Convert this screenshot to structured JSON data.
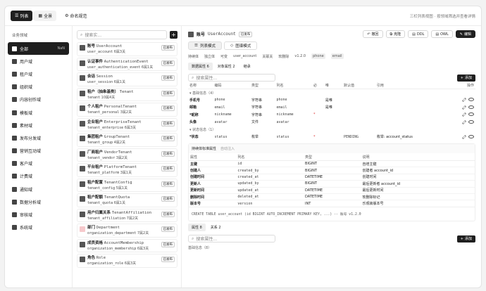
{
  "topbar": {
    "tabs": [
      "列表",
      "全景"
    ],
    "link": "命名规范",
    "hint": "三栏列表视图 · 按领域筛选并查看详情"
  },
  "sidebar": {
    "head": "业务领域",
    "items": [
      {
        "label": "全部",
        "count": "NaN"
      },
      {
        "label": "用户域"
      },
      {
        "label": "租户域"
      },
      {
        "label": "组织域"
      },
      {
        "label": "内容创作域"
      },
      {
        "label": "模板域"
      },
      {
        "label": "素材域"
      },
      {
        "label": "发布分发域"
      },
      {
        "label": "营销互动域"
      },
      {
        "label": "客户域"
      },
      {
        "label": "计费域"
      },
      {
        "label": "通知域"
      },
      {
        "label": "数据分析域"
      },
      {
        "label": "审核域"
      },
      {
        "label": "系统域"
      }
    ]
  },
  "list": {
    "search_placeholder": "搜索实...",
    "plus": "+",
    "entities": [
      {
        "cn": "账号",
        "en": "UserAccount",
        "tbl": "user_account",
        "meta": "6属3关",
        "pub": "已发布"
      },
      {
        "cn": "认证事件",
        "en": "AuthenticationEvent",
        "tbl": "user_authentication_event",
        "meta": "6属1关",
        "pub": "已发布"
      },
      {
        "cn": "会话",
        "en": "Session",
        "tbl": "user_session",
        "meta": "6属1关",
        "pub": "已发布"
      },
      {
        "cn": "租户（抽象基类）",
        "en": "Tenant",
        "tbl": "tenant",
        "meta": "10属4关",
        "pub": "已发布"
      },
      {
        "cn": "个人租户",
        "en": "PersonalTenant",
        "tbl": "tenant_personal",
        "meta": "3属2关",
        "pub": "已发布"
      },
      {
        "cn": "企业租户",
        "en": "EnterpriseTenant",
        "tbl": "tenant_enterprise",
        "meta": "6属3关",
        "pub": "已发布"
      },
      {
        "cn": "集团租户",
        "en": "GroupTenant",
        "tbl": "tenant_group",
        "meta": "4属2关",
        "pub": "已发布"
      },
      {
        "cn": "厂商租户",
        "en": "VendorTenant",
        "tbl": "tenant_vendor",
        "meta": "3属2关",
        "pub": "已发布"
      },
      {
        "cn": "平台租户",
        "en": "PlatformTenant",
        "tbl": "tenant_platform",
        "meta": "3属1关",
        "pub": "已发布"
      },
      {
        "cn": "租户配置",
        "en": "TenantConfig",
        "tbl": "tenant_config",
        "meta": "5属1关",
        "pub": "已发布"
      },
      {
        "cn": "租户配额",
        "en": "TenantQuota",
        "tbl": "tenant_quota",
        "meta": "6属1关",
        "pub": "已发布"
      },
      {
        "cn": "用户归属关系",
        "en": "TenantAffiliation",
        "tbl": "tenant_affiliation",
        "meta": "7属2关",
        "pub": "已发布"
      },
      {
        "cn": "部门",
        "en": "Department",
        "tbl": "organization_department",
        "meta": "7属2关",
        "pub": "已发布"
      },
      {
        "cn": "成员资格",
        "en": "AccountMembership",
        "tbl": "organization_membership",
        "meta": "6属3关",
        "pub": "已发布"
      },
      {
        "cn": "角色",
        "en": "Role",
        "tbl": "organization_role",
        "meta": "6属3关",
        "pub": "已发布"
      }
    ]
  },
  "main": {
    "title": "账号",
    "en": "UserAccount",
    "pub": "已发布",
    "actions": [
      "撤回",
      "克隆",
      "DDL",
      "OWL",
      "编辑"
    ],
    "modes": [
      "列表模式",
      "图谱模式"
    ],
    "tags": [
      "持续体",
      "独立体",
      "可变",
      "user_account",
      "关联关",
      "软删除",
      "v1.2.0",
      "phone",
      "email"
    ],
    "subtabs": [
      "数据属性 6",
      "对象属性 2",
      "继承"
    ],
    "search_placeholder": "搜索属性...",
    "add": "添加",
    "cols": [
      "名称",
      "编码",
      "类型",
      "列名",
      "必",
      "唯",
      "默认值",
      "引用",
      "操作"
    ],
    "groups": [
      {
        "name": "基础信息（4）",
        "rows": [
          {
            "name": "手机号",
            "code": "phone",
            "type": "字符串",
            "col": "phone",
            "req": "",
            "uniq": "是唯",
            "def": "",
            "ref": ""
          },
          {
            "name": "邮箱",
            "code": "email",
            "type": "字符串",
            "col": "email",
            "req": "",
            "uniq": "是唯",
            "def": "",
            "ref": ""
          },
          {
            "name": "*昵称",
            "code": "nickname",
            "type": "字符串",
            "col": "nickname",
            "req": "*",
            "uniq": "",
            "def": "",
            "ref": ""
          },
          {
            "name": "头像",
            "code": "avatar",
            "type": "文件",
            "col": "avatar",
            "req": "",
            "uniq": "",
            "def": "",
            "ref": ""
          }
        ]
      },
      {
        "name": "状态信息（1）",
        "rows": [
          {
            "name": "*状态",
            "code": "status",
            "type": "枚举",
            "col": "status",
            "req": "*",
            "uniq": "",
            "def": "PENDING",
            "ref": "枚举: account_status"
          }
        ]
      }
    ],
    "inherit": {
      "title": "持续体标准属性",
      "note": "自动注入",
      "cols": [
        "属性",
        "列名",
        "类型",
        "说明"
      ],
      "rows": [
        [
          "主键",
          "id",
          "BIGINT",
          "自增主键"
        ],
        [
          "创建人",
          "created_by",
          "BIGINT",
          "创建者 account_id"
        ],
        [
          "创建时间",
          "created_at",
          "DATETIME",
          "创建时间"
        ],
        [
          "更新人",
          "updated_by",
          "BIGINT",
          "最后更新者 account_id"
        ],
        [
          "更新时间",
          "updated_at",
          "DATETIME",
          "最后更新时间"
        ],
        [
          "删除时间",
          "deleted_at",
          "DATETIME",
          "软删除标记"
        ],
        [
          "版本号",
          "version",
          "INT",
          "乐观锁版本号"
        ]
      ]
    },
    "sql": "CREATE TABLE user_account (id BIGINT AUTO_INCREMENT PRIMARY KEY, ...) -- 账号 v1.2.0",
    "subtabs2": [
      "属性 8",
      "关系 2"
    ],
    "search2": "搜索属性...",
    "group2": "基础信息（8）"
  }
}
